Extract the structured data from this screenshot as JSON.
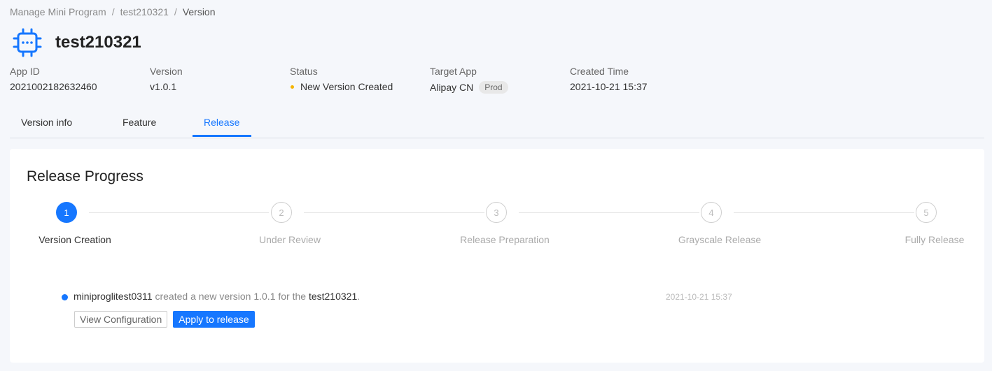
{
  "breadcrumb": {
    "items": [
      "Manage Mini Program",
      "test210321",
      "Version"
    ],
    "separator": "/"
  },
  "header": {
    "title": "test210321",
    "icon": "chip-icon"
  },
  "meta": {
    "app_id": {
      "label": "App ID",
      "value": "2021002182632460"
    },
    "version": {
      "label": "Version",
      "value": "v1.0.1"
    },
    "status": {
      "label": "Status",
      "value": "New Version Created",
      "dot_color": "#f5b400"
    },
    "target_app": {
      "label": "Target App",
      "value": "Alipay CN",
      "badge": "Prod"
    },
    "created_time": {
      "label": "Created Time",
      "value": "2021-10-21 15:37"
    }
  },
  "tabs": [
    {
      "label": "Version info",
      "active": false
    },
    {
      "label": "Feature",
      "active": false
    },
    {
      "label": "Release",
      "active": true
    }
  ],
  "release": {
    "title": "Release Progress",
    "current_step": 1,
    "steps": [
      {
        "number": "1",
        "label": "Version Creation"
      },
      {
        "number": "2",
        "label": "Under Review"
      },
      {
        "number": "3",
        "label": "Release Preparation"
      },
      {
        "number": "4",
        "label": "Grayscale Release"
      },
      {
        "number": "5",
        "label": "Fully Release"
      }
    ],
    "timeline": {
      "user": "miniproglitest0311",
      "text_middle": "created a new version 1.0.1 for the",
      "app": "test210321",
      "text_end": ".",
      "time": "2021-10-21 15:37",
      "view_button": "View Configuration",
      "apply_button": "Apply to release"
    }
  },
  "colors": {
    "accent": "#1677ff",
    "background": "#f5f7fb"
  }
}
